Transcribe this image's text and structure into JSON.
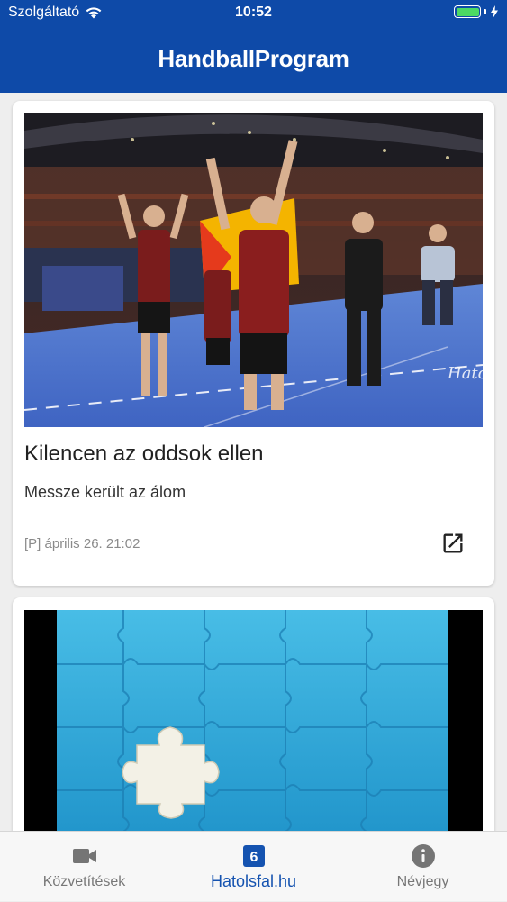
{
  "status_bar": {
    "carrier": "Szolgáltató",
    "time": "10:52"
  },
  "header": {
    "title": "HandballProgram"
  },
  "articles": [
    {
      "title": "Kilencen az oddsok ellen",
      "subtitle": "Messze került az álom",
      "meta": "[P] április 26. 21:02",
      "image_watermark": "Hatolsfal"
    }
  ],
  "bottom_nav": [
    {
      "label": "Közvetítések",
      "icon": "video-camera-icon",
      "active": false
    },
    {
      "label": "Hatolsfal.hu",
      "icon": "six-badge-icon",
      "badge": "6",
      "active": true
    },
    {
      "label": "Névjegy",
      "icon": "info-icon",
      "active": false
    }
  ],
  "colors": {
    "header": "#0e4aa8",
    "active_tab": "#1553b0",
    "battery": "#4cd964"
  }
}
